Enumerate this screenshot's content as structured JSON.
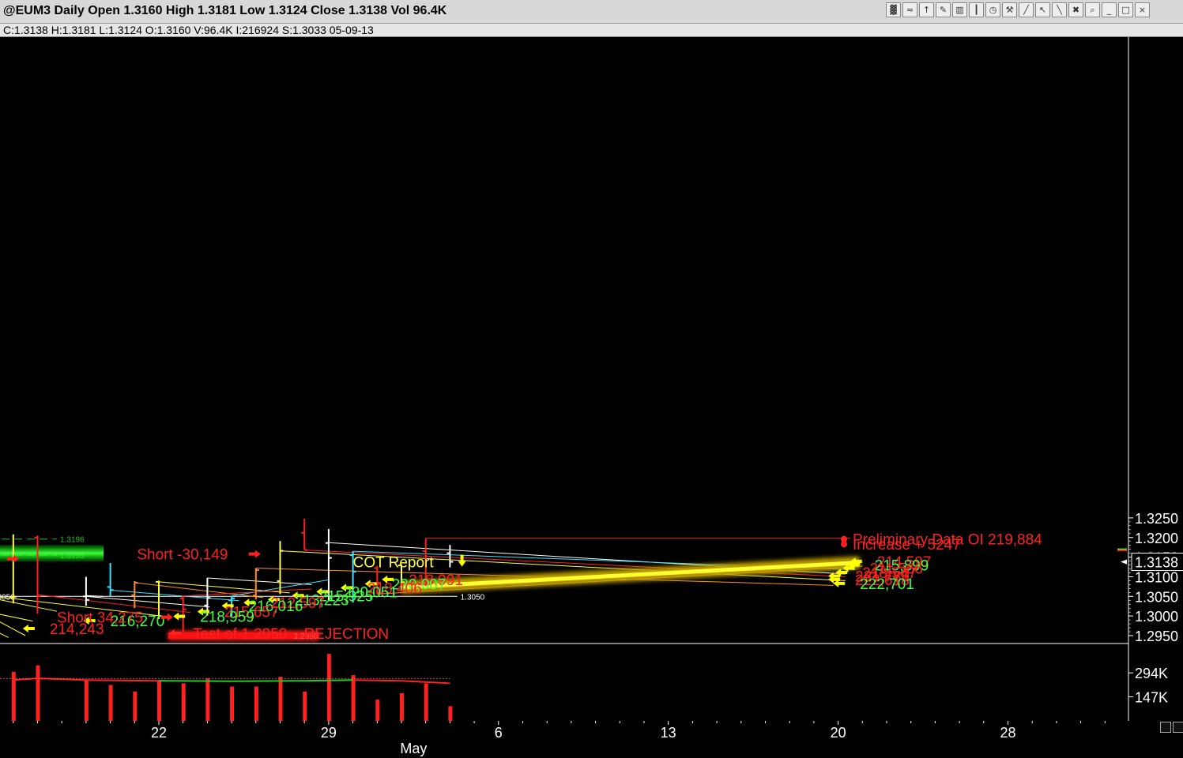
{
  "window": {
    "title": "@EUM3 Daily Open 1.3160 High 1.3181 Low 1.3124 Close 1.3138 Vol 96.4K",
    "status": "C:1.3138  H:1.3181  L:1.3124  O:1.3160  V:96.4K  I:216924  S:1.3033  05-09-13",
    "toolbar_icons": [
      "bar-chart-icon",
      "indicator-icon",
      "drawing-icon",
      "pencil-icon",
      "chart-type-icon",
      "candle-icon",
      "clock-icon",
      "tool-icon",
      "line-icon",
      "cursor-icon",
      "trendline-icon",
      "delete-icon",
      "zoom-icon",
      "minimize-icon",
      "maximize-icon",
      "close-icon"
    ]
  },
  "chart_data": {
    "type": "bar",
    "title": "@EUM3 Daily",
    "y_axis": {
      "ticks": [
        1.325,
        1.32,
        1.315,
        1.31,
        1.305,
        1.3,
        1.295
      ],
      "tick_labels": [
        "1.3250",
        "1.3200",
        "1.3150",
        "1.3100",
        "1.3050",
        "1.3000",
        "1.2950"
      ],
      "last_price_label": "1.3138",
      "ylim": [
        1.2945,
        1.3268
      ]
    },
    "x_axis": {
      "labels": [
        {
          "text": "22",
          "day": 0
        },
        {
          "text": "29",
          "day": 7
        },
        {
          "text": "6",
          "day": 14
        },
        {
          "text": "13",
          "day": 21
        },
        {
          "text": "20",
          "day": 28
        },
        {
          "text": "28",
          "day": 35
        }
      ],
      "month_label": "May",
      "month_day": 10.5
    },
    "bars": [
      {
        "day": -6,
        "o": 1.3048,
        "h": 1.3208,
        "l": 1.3032,
        "c": 1.3049,
        "color": "#ffff40"
      },
      {
        "day": -5,
        "o": 1.32,
        "h": 1.3205,
        "l": 1.3006,
        "c": 1.305,
        "color": "#ff2020"
      },
      {
        "day": -3,
        "o": 1.305,
        "h": 1.31,
        "l": 1.3026,
        "c": 1.3041,
        "color": "#ffffff"
      },
      {
        "day": -2,
        "o": 1.3074,
        "h": 1.3135,
        "l": 1.3051,
        "c": 1.3066,
        "color": "#40e0ff"
      },
      {
        "day": -1,
        "o": 1.3053,
        "h": 1.3089,
        "l": 1.302,
        "c": 1.3085,
        "color": "#ff9020"
      },
      {
        "day": 0,
        "o": 1.3087,
        "h": 1.309,
        "l": 1.2992,
        "c": 1.3,
        "color": "#ffff40"
      },
      {
        "day": 1,
        "o": 1.3045,
        "h": 1.3051,
        "l": 1.296,
        "c": 1.3017,
        "color": "#ff2020"
      },
      {
        "day": 2,
        "o": 1.3027,
        "h": 1.3097,
        "l": 1.3001,
        "c": 1.3046,
        "color": "#ffffff"
      },
      {
        "day": 3,
        "o": 1.304,
        "h": 1.3051,
        "l": 1.3,
        "c": 1.3045,
        "color": "#40e0ff"
      },
      {
        "day": 4,
        "o": 1.3052,
        "h": 1.3122,
        "l": 1.3042,
        "c": 1.3117,
        "color": "#ff9020"
      },
      {
        "day": 5,
        "o": 1.3089,
        "h": 1.3191,
        "l": 1.3056,
        "c": 1.3166,
        "color": "#ffff40"
      },
      {
        "day": 6,
        "o": 1.3212,
        "h": 1.3248,
        "l": 1.3169,
        "c": 1.3168,
        "color": "#ff2020"
      },
      {
        "day": 7,
        "o": 1.3186,
        "h": 1.3222,
        "l": 1.304,
        "c": 1.3148,
        "color": "#ffffff"
      },
      {
        "day": 8,
        "o": 1.3155,
        "h": 1.3165,
        "l": 1.3034,
        "c": 1.3113,
        "color": "#40e0ff"
      },
      {
        "day": 9,
        "o": 1.3122,
        "h": 1.3128,
        "l": 1.3056,
        "c": 1.3085,
        "color": "#ff2020"
      },
      {
        "day": 10,
        "o": 1.3129,
        "h": 1.3131,
        "l": 1.3066,
        "c": 1.3086,
        "color": "#ffff40"
      },
      {
        "day": 11,
        "o": 1.3165,
        "h": 1.3198,
        "l": 1.3076,
        "c": 1.3081,
        "color": "#ff2020"
      },
      {
        "day": 12,
        "o": 1.316,
        "h": 1.3181,
        "l": 1.3124,
        "c": 1.3138,
        "color": "#ffffff"
      }
    ],
    "volume": {
      "tick_labels": [
        "294K",
        "147K"
      ],
      "ticks": [
        294,
        147
      ],
      "max": 430,
      "values": [
        {
          "day": -6,
          "v": 300,
          "c": "#ff2020"
        },
        {
          "day": -5,
          "v": 340,
          "c": "#ff2020"
        },
        {
          "day": -3,
          "v": 250,
          "c": "#ff2020"
        },
        {
          "day": -2,
          "v": 220,
          "c": "#ff2020"
        },
        {
          "day": -1,
          "v": 180,
          "c": "#ff2020"
        },
        {
          "day": 0,
          "v": 250,
          "c": "#ff2020"
        },
        {
          "day": 1,
          "v": 230,
          "c": "#ff2020"
        },
        {
          "day": 2,
          "v": 260,
          "c": "#ff2020"
        },
        {
          "day": 3,
          "v": 210,
          "c": "#ff2020"
        },
        {
          "day": 4,
          "v": 210,
          "c": "#ff2020"
        },
        {
          "day": 5,
          "v": 270,
          "c": "#ff2020"
        },
        {
          "day": 6,
          "v": 180,
          "c": "#ff2020"
        },
        {
          "day": 7,
          "v": 410,
          "c": "#ff2020"
        },
        {
          "day": 8,
          "v": 280,
          "c": "#ff2020"
        },
        {
          "day": 9,
          "v": 130,
          "c": "#ff2020"
        },
        {
          "day": 10,
          "v": 170,
          "c": "#ff2020"
        },
        {
          "day": 11,
          "v": 230,
          "c": "#ff2020"
        },
        {
          "day": 12,
          "v": 90,
          "c": "#ff2020"
        }
      ],
      "avg_line": [
        {
          "day": -6,
          "v": 250
        },
        {
          "day": -5,
          "v": 260
        },
        {
          "day": -3,
          "v": 250
        },
        {
          "day": 0,
          "v": 245
        },
        {
          "day": 3,
          "v": 243
        },
        {
          "day": 6,
          "v": 245
        },
        {
          "day": 8,
          "v": 250
        },
        {
          "day": 10,
          "v": 245
        },
        {
          "day": 12,
          "v": 230
        }
      ]
    },
    "levels": [
      {
        "price": 1.3196,
        "label": "1.3196",
        "color": "#20c020",
        "d0": -7,
        "d1": -4.2,
        "dashed": true
      },
      {
        "price": 1.3155,
        "label": "1.3155",
        "color": "#20c020",
        "d0": -7,
        "d1": -4.2,
        "dashed": true
      },
      {
        "price": 1.305,
        "label_left": "1.3050",
        "label": "1.3050",
        "color": "#ffffff",
        "d0": -7,
        "d1": 12.3,
        "dashed": false
      },
      {
        "price": 1.295,
        "label_left": "1.2950",
        "color": "#ff2020",
        "d0": -1.5,
        "d1": 6.6,
        "dashed": false
      }
    ],
    "oi_lines": [
      {
        "d0": -7,
        "p0": 1.3047,
        "d1": -4.2,
        "p1": 1.3012,
        "c": "#ffff40"
      },
      {
        "d0": -7,
        "p0": 1.301,
        "d1": -5.2,
        "p1": 1.2987,
        "c": "#ffff40"
      },
      {
        "d0": -7,
        "p0": 1.3,
        "d1": -5.5,
        "p1": 1.295,
        "c": "#ffff40"
      },
      {
        "d0": -7,
        "p0": 1.297,
        "d1": -6.2,
        "p1": 1.2945,
        "c": "#ffff40"
      },
      {
        "d0": -5,
        "p0": 1.3054,
        "d1": -3.9,
        "p1": 1.3047,
        "c": "#ff2020"
      },
      {
        "d0": -3,
        "p0": 1.3052,
        "d1": -2.3,
        "p1": 1.305,
        "c": "#ffffff"
      },
      {
        "d0": -2,
        "p0": 1.3066,
        "d1": -2.0,
        "p1": 1.3066,
        "c": "#40e0ff"
      },
      {
        "d0": -5,
        "p0": 1.3054,
        "d1": 1.3,
        "p1": 1.3009,
        "c": "#ff2020"
      },
      {
        "d0": -3,
        "p0": 1.305,
        "d1": 2.1,
        "p1": 1.3023,
        "c": "#ffffff"
      },
      {
        "d0": -2,
        "p0": 1.3066,
        "d1": 3.3,
        "p1": 1.3039,
        "c": "#40e0ff"
      },
      {
        "d0": -1,
        "p0": 1.3085,
        "d1": 4.3,
        "p1": 1.3047,
        "c": "#ff9020"
      },
      {
        "d0": 0,
        "p0": 1.3087,
        "d1": 5.4,
        "p1": 1.3059,
        "c": "#ffff40"
      },
      {
        "d0": -6.9,
        "p0": 1.3051,
        "d1": 0.5,
        "p1": 1.2997,
        "c": "#ffff40"
      },
      {
        "d0": 2,
        "p0": 1.3097,
        "d1": 6.3,
        "p1": 1.308,
        "c": "#ffffff"
      },
      {
        "d0": 3,
        "p0": 1.3051,
        "d1": 7.0,
        "p1": 1.3092,
        "c": "#40e0ff"
      },
      {
        "d0": 1,
        "p0": 1.3051,
        "d1": 6.3,
        "p1": 1.3069,
        "c": "#ff2020"
      },
      {
        "d0": 4,
        "p0": 1.3122,
        "d1": 27.8,
        "p1": 1.3078,
        "c": "#ff9020"
      },
      {
        "d0": 5,
        "p0": 1.3166,
        "d1": 28.3,
        "p1": 1.309,
        "c": "#ffff40"
      },
      {
        "d0": 6,
        "p0": 1.3168,
        "d1": 28.3,
        "p1": 1.31,
        "c": "#ff2020"
      },
      {
        "d0": 7,
        "p0": 1.3187,
        "d1": 28.3,
        "p1": 1.3107,
        "c": "#ffffff"
      },
      {
        "d0": 8,
        "p0": 1.3165,
        "d1": 28.7,
        "p1": 1.3118,
        "c": "#40e0ff"
      },
      {
        "d0": 9,
        "p0": 1.3056,
        "d1": 29.0,
        "p1": 1.3127,
        "c": "#ff9020"
      },
      {
        "d0": 11,
        "p0": 1.3198,
        "d1": 28.5,
        "p1": 1.3198,
        "c": "#ff2020"
      }
    ],
    "trend_band": {
      "d0": 10,
      "p0": 1.3073,
      "d1": 28.9,
      "p1": 1.3136,
      "c": "#ffff00"
    },
    "annotations": [
      {
        "text": "Preliminary Data   OI 219,884",
        "color": "#ff2020",
        "bullet": true,
        "d": 28.6,
        "p": 1.3196
      },
      {
        "text": "Increase  + 5247",
        "color": "#ff2020",
        "bullet": true,
        "d": 28.6,
        "p": 1.3183
      },
      {
        "text": "Short  -30,149",
        "color": "#ff2020",
        "d": -0.9,
        "p": 1.3158,
        "arrow": "right"
      },
      {
        "text": "COT Report",
        "color": "#ffff40",
        "d": 8.0,
        "p": 1.3138,
        "arrow": "down"
      },
      {
        "text": "Short  34,275",
        "color": "#ff2020",
        "d": -4.2,
        "p": 1.2997,
        "arrow": "right"
      },
      {
        "text": "Test of 1.2950   ..  REJECTION",
        "color": "#ff2020",
        "d": 1.4,
        "p": 1.2956,
        "arrow": "left"
      }
    ],
    "oi_labels": [
      {
        "text": "214,597",
        "color": "#ff2020",
        "d": 29.6,
        "p": 1.3137
      },
      {
        "text": "215,899",
        "color": "#40ff40",
        "d": 29.5,
        "p": 1.3128
      },
      {
        "text": "211,566",
        "color": "#ff2020",
        "d": 29.3,
        "p": 1.312
      },
      {
        "text": "218,547",
        "color": "#ff2020",
        "d": 29.0,
        "p": 1.3109
      },
      {
        "text": "221,789",
        "color": "#ff2020",
        "d": 28.7,
        "p": 1.31
      },
      {
        "text": "222,618",
        "color": "#ff2020",
        "d": 28.7,
        "p": 1.3091
      },
      {
        "text": "222,701",
        "color": "#40ff40",
        "d": 28.9,
        "p": 1.3081
      },
      {
        "text": "218,991",
        "color": "#ff2020",
        "d": 10.3,
        "p": 1.3091
      },
      {
        "text": "220,007",
        "color": "#40ff40",
        "d": 9.6,
        "p": 1.308
      },
      {
        "text": "218,406",
        "color": "#ff2020",
        "d": 8.6,
        "p": 1.307
      },
      {
        "text": "220,051",
        "color": "#40ff40",
        "d": 7.6,
        "p": 1.306
      },
      {
        "text": "215,925",
        "color": "#40ff40",
        "d": 6.6,
        "p": 1.305
      },
      {
        "text": "213,223",
        "color": "#40ff40",
        "d": 5.6,
        "p": 1.304
      },
      {
        "text": "212,597",
        "color": "#ff2020",
        "d": 4.6,
        "p": 1.3032
      },
      {
        "text": "216,016",
        "color": "#40ff40",
        "d": 3.7,
        "p": 1.3024
      },
      {
        "text": "215,657",
        "color": "#ff2020",
        "d": 2.7,
        "p": 1.3009
      },
      {
        "text": "218,959",
        "color": "#40ff40",
        "d": 1.7,
        "p": 1.2997
      },
      {
        "text": "216,270",
        "color": "#40ff40",
        "d": -2.0,
        "p": 1.2986
      },
      {
        "text": "214,243",
        "color": "#ff2020",
        "d": -4.5,
        "p": 1.2966
      }
    ],
    "grid": false,
    "colors": {
      "background": "#000000",
      "axis": "#ffffff",
      "up": "#40ff40",
      "down": "#ff2020",
      "arrow": "#ffff00"
    }
  }
}
